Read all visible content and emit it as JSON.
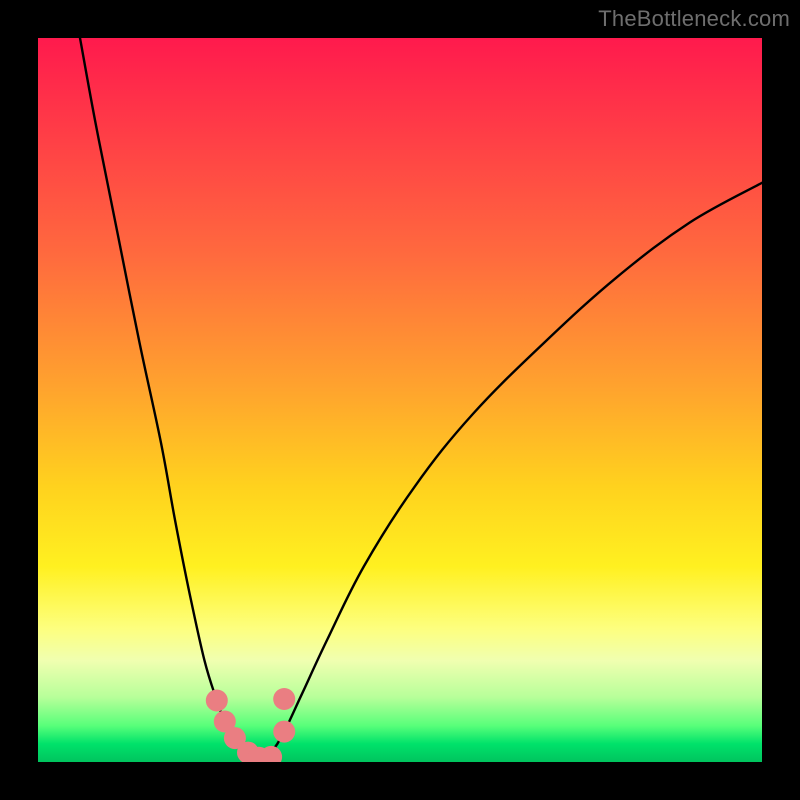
{
  "watermark": {
    "text": "TheBottleneck.com"
  },
  "colors": {
    "background": "#000000",
    "curve": "#000000",
    "dot": "#ea7e82",
    "gradient_top": "#ff1a4d",
    "gradient_bottom": "#00c45e"
  },
  "chart_data": {
    "type": "line",
    "title": "",
    "xlabel": "",
    "ylabel": "",
    "xlim": [
      0,
      100
    ],
    "ylim": [
      0,
      100
    ],
    "note": "No axis ticks or numeric labels are shown in the image; x and y are normalized 0–100 to the visible plot area (y=0 at bottom). Values are read from pixel positions.",
    "series": [
      {
        "name": "left-curve",
        "x": [
          5.8,
          8,
          11,
          14,
          17,
          19,
          21,
          23,
          24.7,
          25.8,
          27.2,
          29,
          30.5
        ],
        "y": [
          100,
          88,
          73,
          58,
          44,
          33,
          23,
          14,
          8.5,
          5.6,
          3.3,
          1.3,
          0.6
        ]
      },
      {
        "name": "right-curve",
        "x": [
          30.5,
          32.2,
          34,
          36.5,
          40,
          45,
          52,
          60,
          70,
          80,
          90,
          100
        ],
        "y": [
          0.6,
          1.4,
          4.2,
          9.5,
          17,
          27,
          38,
          48,
          58,
          67,
          74.5,
          80
        ]
      }
    ],
    "dots": {
      "name": "highlight-dots",
      "x": [
        24.7,
        25.8,
        27.2,
        29.0,
        30.5,
        32.2,
        34.0,
        34.0
      ],
      "y": [
        8.5,
        5.6,
        3.3,
        1.3,
        0.6,
        0.7,
        4.2,
        8.7
      ]
    }
  }
}
